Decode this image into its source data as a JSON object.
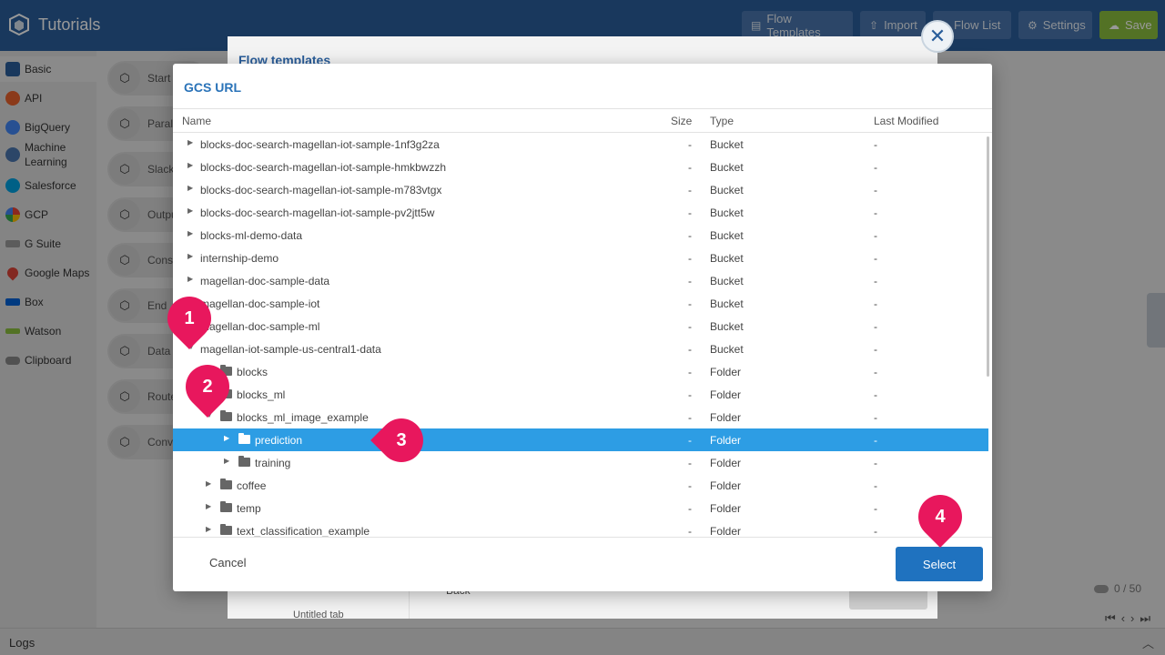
{
  "app": {
    "title": "Tutorials"
  },
  "toolbar": {
    "flow_templates": "Flow Templates",
    "import": "Import",
    "flow_list": "Flow List",
    "settings": "Settings",
    "save": "Save"
  },
  "sidebar": {
    "items": [
      {
        "label": "Basic",
        "icon": "basic-icon",
        "color": "#2a5e9b"
      },
      {
        "label": "API",
        "icon": "api-icon",
        "color": "#e8612c"
      },
      {
        "label": "BigQuery",
        "icon": "bigquery-icon",
        "color": "#4285f4"
      },
      {
        "label": "Machine Learning",
        "icon": "machine-learning-icon",
        "color": "#4a76ad"
      },
      {
        "label": "Salesforce",
        "icon": "salesforce-icon",
        "color": "#00a1e0"
      },
      {
        "label": "GCP",
        "icon": "gcp-icon",
        "color": "#ea4335"
      },
      {
        "label": "G Suite",
        "icon": "gsuite-icon",
        "color": "#777777"
      },
      {
        "label": "Google Maps",
        "icon": "map-pin-icon",
        "color": "#db4437"
      },
      {
        "label": "Box",
        "icon": "box-icon",
        "color": "#0061d5"
      },
      {
        "label": "Watson",
        "icon": "watson-icon",
        "color": "#8bbf3e"
      },
      {
        "label": "Clipboard",
        "icon": "clipboard-icon",
        "color": "#888888"
      }
    ]
  },
  "blocks": [
    "Start",
    "Parall",
    "Slack",
    "Outpu",
    "Const",
    "End",
    "Data",
    "Route",
    "Conve"
  ],
  "background_dialog": {
    "title": "Flow templates",
    "back": "Back",
    "tab": "Untitled tab"
  },
  "counter": "0 / 50",
  "logs": {
    "label": "Logs"
  },
  "modal": {
    "title": "GCS URL",
    "columns": {
      "name": "Name",
      "size": "Size",
      "type": "Type",
      "modified": "Last Modified"
    },
    "rows": [
      {
        "name": "blocks-doc-search-magellan-iot-sample-1nf3g2za",
        "size": "-",
        "type": "Bucket",
        "modified": "-"
      },
      {
        "name": "blocks-doc-search-magellan-iot-sample-hmkbwzzh",
        "size": "-",
        "type": "Bucket",
        "modified": "-"
      },
      {
        "name": "blocks-doc-search-magellan-iot-sample-m783vtgx",
        "size": "-",
        "type": "Bucket",
        "modified": "-"
      },
      {
        "name": "blocks-doc-search-magellan-iot-sample-pv2jtt5w",
        "size": "-",
        "type": "Bucket",
        "modified": "-"
      },
      {
        "name": "blocks-ml-demo-data",
        "size": "-",
        "type": "Bucket",
        "modified": "-"
      },
      {
        "name": "internship-demo",
        "size": "-",
        "type": "Bucket",
        "modified": "-"
      },
      {
        "name": "magellan-doc-sample-data",
        "size": "-",
        "type": "Bucket",
        "modified": "-"
      },
      {
        "name": "magellan-doc-sample-iot",
        "size": "-",
        "type": "Bucket",
        "modified": "-"
      },
      {
        "name": "magellan-doc-sample-ml",
        "size": "-",
        "type": "Bucket",
        "modified": "-"
      },
      {
        "name": "magellan-iot-sample-us-central1-data",
        "size": "-",
        "type": "Bucket",
        "modified": "-"
      },
      {
        "name": "blocks",
        "size": "-",
        "type": "Folder",
        "modified": "-"
      },
      {
        "name": "blocks_ml",
        "size": "-",
        "type": "Folder",
        "modified": "-"
      },
      {
        "name": "blocks_ml_image_example",
        "size": "-",
        "type": "Folder",
        "modified": "-"
      },
      {
        "name": "prediction",
        "size": "-",
        "type": "Folder",
        "modified": "-"
      },
      {
        "name": "training",
        "size": "-",
        "type": "Folder",
        "modified": "-"
      },
      {
        "name": "coffee",
        "size": "-",
        "type": "Folder",
        "modified": "-"
      },
      {
        "name": "temp",
        "size": "-",
        "type": "Folder",
        "modified": "-"
      },
      {
        "name": "text_classification_example",
        "size": "-",
        "type": "Folder",
        "modified": "-"
      }
    ],
    "cancel": "Cancel",
    "select": "Select"
  },
  "markers": [
    "1",
    "2",
    "3",
    "4"
  ],
  "colors": {
    "header": "#2a5e9b",
    "accent": "#2d9de4",
    "marker": "#e8175d",
    "save": "#8bbf3e"
  }
}
